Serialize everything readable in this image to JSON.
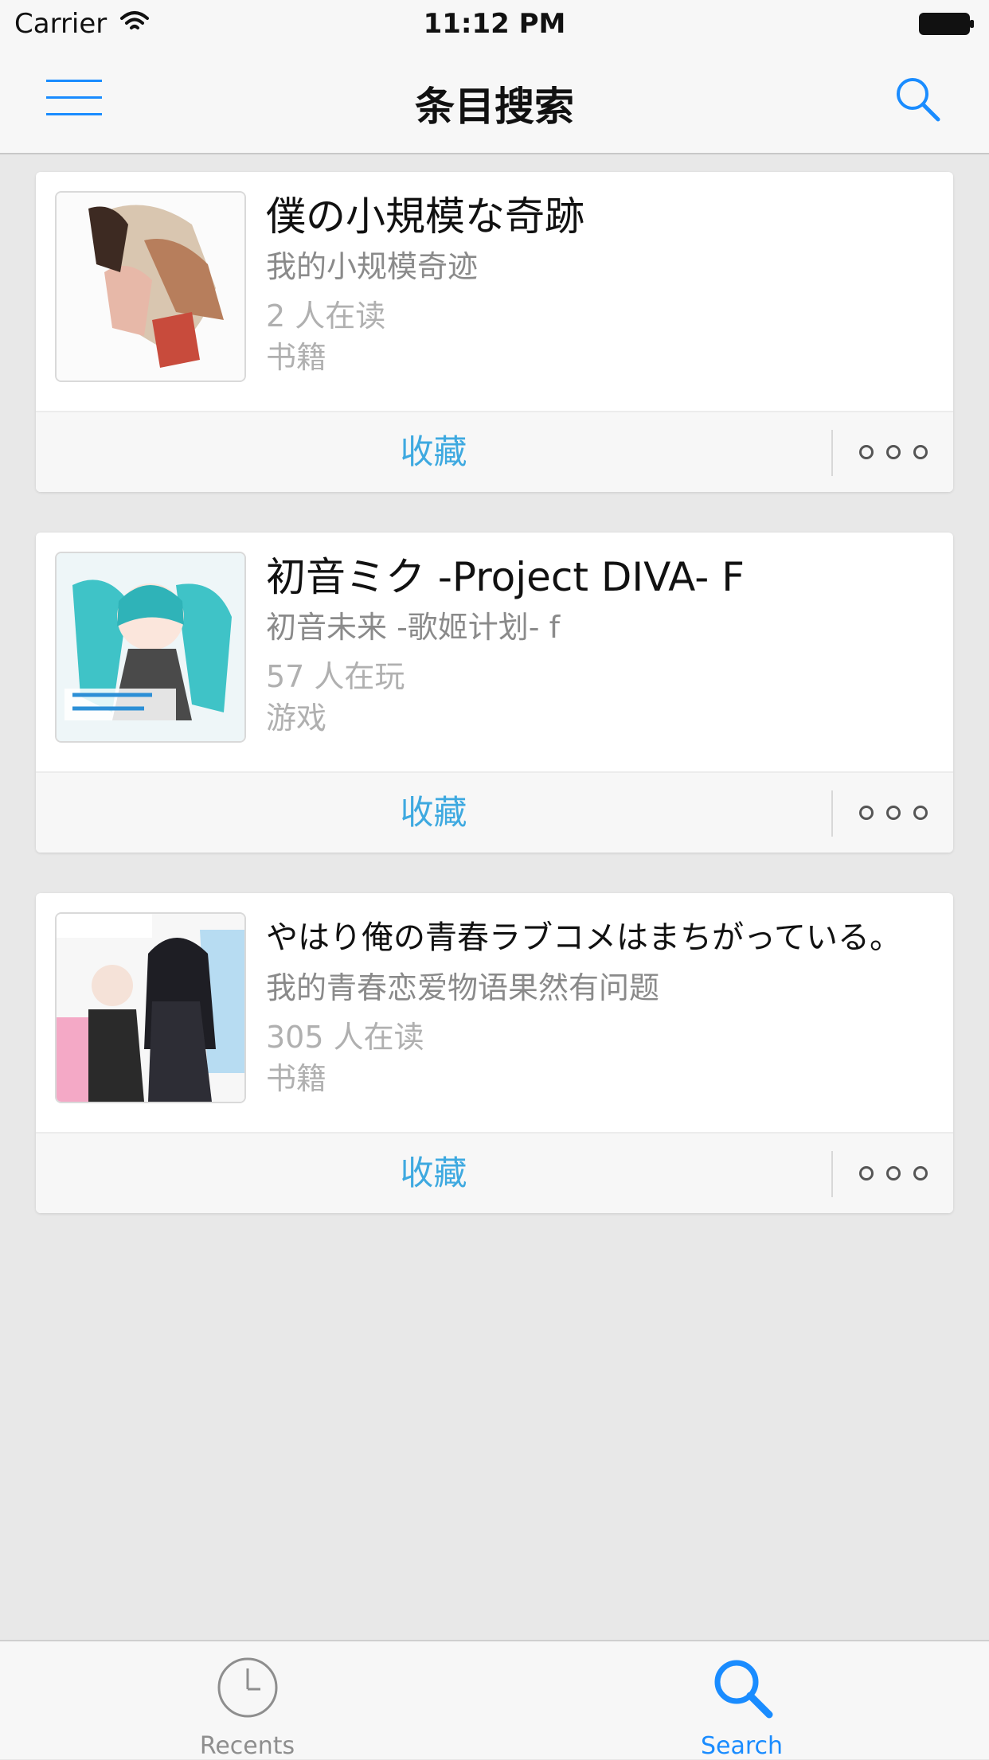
{
  "status_bar": {
    "carrier": "Carrier",
    "time": "11:12 PM"
  },
  "nav": {
    "title": "条目搜索"
  },
  "results": [
    {
      "title": "僕の小規模な奇跡",
      "subtitle": "我的小规模奇迹",
      "count": "2 人在读",
      "type": "书籍",
      "action": "收藏"
    },
    {
      "title": "初音ミク -Project DIVA- F",
      "subtitle": "初音未来 -歌姬计划- f",
      "count": "57 人在玩",
      "type": "游戏",
      "action": "收藏"
    },
    {
      "title": "やはり俺の青春ラブコメはまちがっている。",
      "subtitle": "我的青春恋爱物语果然有问题",
      "count": "305 人在读",
      "type": "书籍",
      "action": "收藏"
    }
  ],
  "tabs": {
    "recents": "Recents",
    "search": "Search"
  },
  "colors": {
    "accent": "#1a8cff",
    "favorite": "#3ea9e0",
    "background": "#e8e8e8"
  },
  "icons": [
    "menu-icon",
    "search-icon",
    "clock-icon",
    "more-icon",
    "wifi-icon",
    "battery-icon"
  ]
}
